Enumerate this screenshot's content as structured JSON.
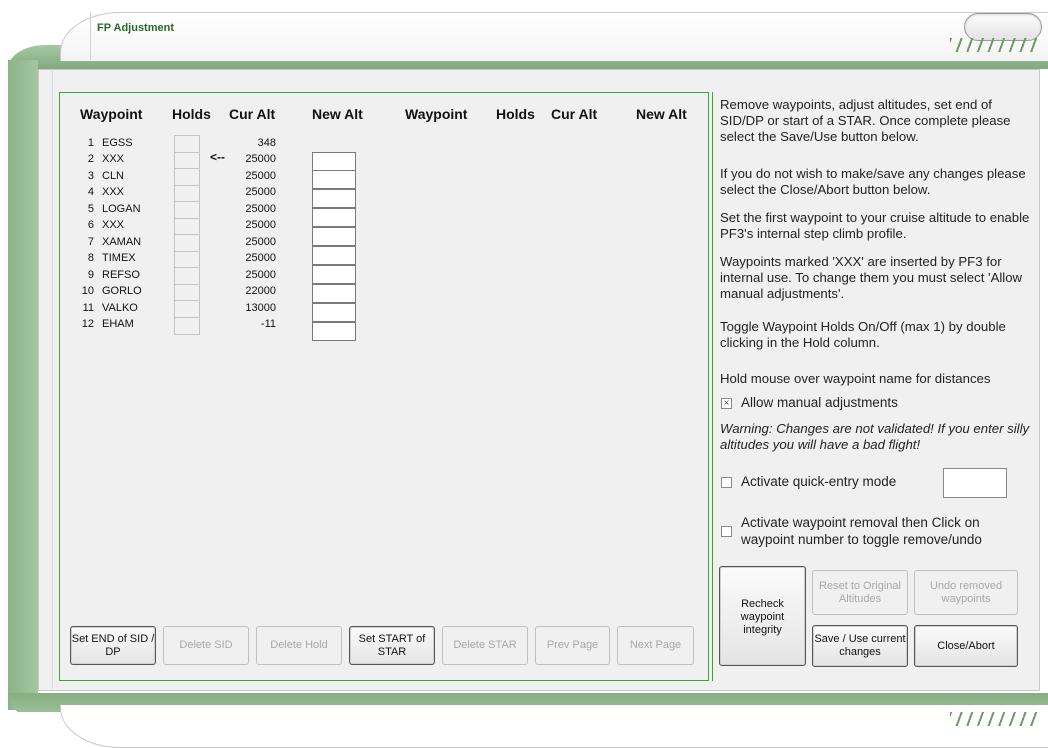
{
  "window": {
    "title": "FP Adjustment"
  },
  "headers": {
    "waypoint": "Waypoint",
    "holds": "Holds",
    "cur_alt": "Cur Alt",
    "new_alt": "New Alt",
    "waypoint2": "Waypoint",
    "holds2": "Holds",
    "cur_alt2": "Cur Alt",
    "new_alt2": "New Alt"
  },
  "rows": [
    {
      "num": "1",
      "name": "EGSS",
      "alt": "348"
    },
    {
      "num": "2",
      "name": "XXX",
      "alt": "25000"
    },
    {
      "num": "3",
      "name": "CLN",
      "alt": "25000"
    },
    {
      "num": "4",
      "name": "XXX",
      "alt": "25000"
    },
    {
      "num": "5",
      "name": "LOGAN",
      "alt": "25000"
    },
    {
      "num": "6",
      "name": "XXX",
      "alt": "25000"
    },
    {
      "num": "7",
      "name": "XAMAN",
      "alt": "25000"
    },
    {
      "num": "8",
      "name": "TIMEX",
      "alt": "25000"
    },
    {
      "num": "9",
      "name": "REFSO",
      "alt": "25000"
    },
    {
      "num": "10",
      "name": "GORLO",
      "alt": "22000"
    },
    {
      "num": "11",
      "name": "VALKO",
      "alt": "13000"
    },
    {
      "num": "12",
      "name": "EHAM",
      "alt": "-11"
    }
  ],
  "current_row_marker": "<--",
  "buttons": {
    "set_end_sid": "Set END of SID / DP",
    "delete_sid": "Delete SID",
    "delete_hold": "Delete Hold",
    "set_start_star": "Set START of STAR",
    "delete_star": "Delete STAR",
    "prev_page": "Prev Page",
    "next_page": "Next Page",
    "recheck": "Recheck waypoint integrity",
    "reset_altitudes": "Reset to Original Altitudes",
    "undo_removed": "Undo removed waypoints",
    "save_use": "Save / Use current changes",
    "close_abort": "Close/Abort"
  },
  "help": {
    "p1": "Remove waypoints, adjust altitudes, set end of SID/DP or start of a STAR. Once complete please select the Save/Use button below.",
    "p2": "If you do not wish to make/save any changes please select the Close/Abort button below.",
    "p3": "Set the first waypoint to your cruise altitude to enable PF3's internal step climb profile.",
    "p4": "Waypoints marked 'XXX' are inserted by PF3 for internal use. To change them you must select 'Allow manual adjustments'.",
    "p5": "Toggle Waypoint Holds On/Off (max 1) by double clicking in the Hold column.",
    "p6": "Hold mouse over waypoint name for distances",
    "warning": "Warning: Changes are not validated! If you enter silly altitudes you will have a bad flight!"
  },
  "options": {
    "allow_manual": {
      "label": "Allow manual adjustments",
      "checked": true
    },
    "quick_entry": {
      "label": "Activate quick-entry mode",
      "checked": false
    },
    "removal": {
      "label": "Activate waypoint removal then Click on waypoint number to toggle remove/undo",
      "checked": false
    }
  },
  "colors": {
    "accent_green": "#3aa53a",
    "frame_green": "#8cb388"
  }
}
